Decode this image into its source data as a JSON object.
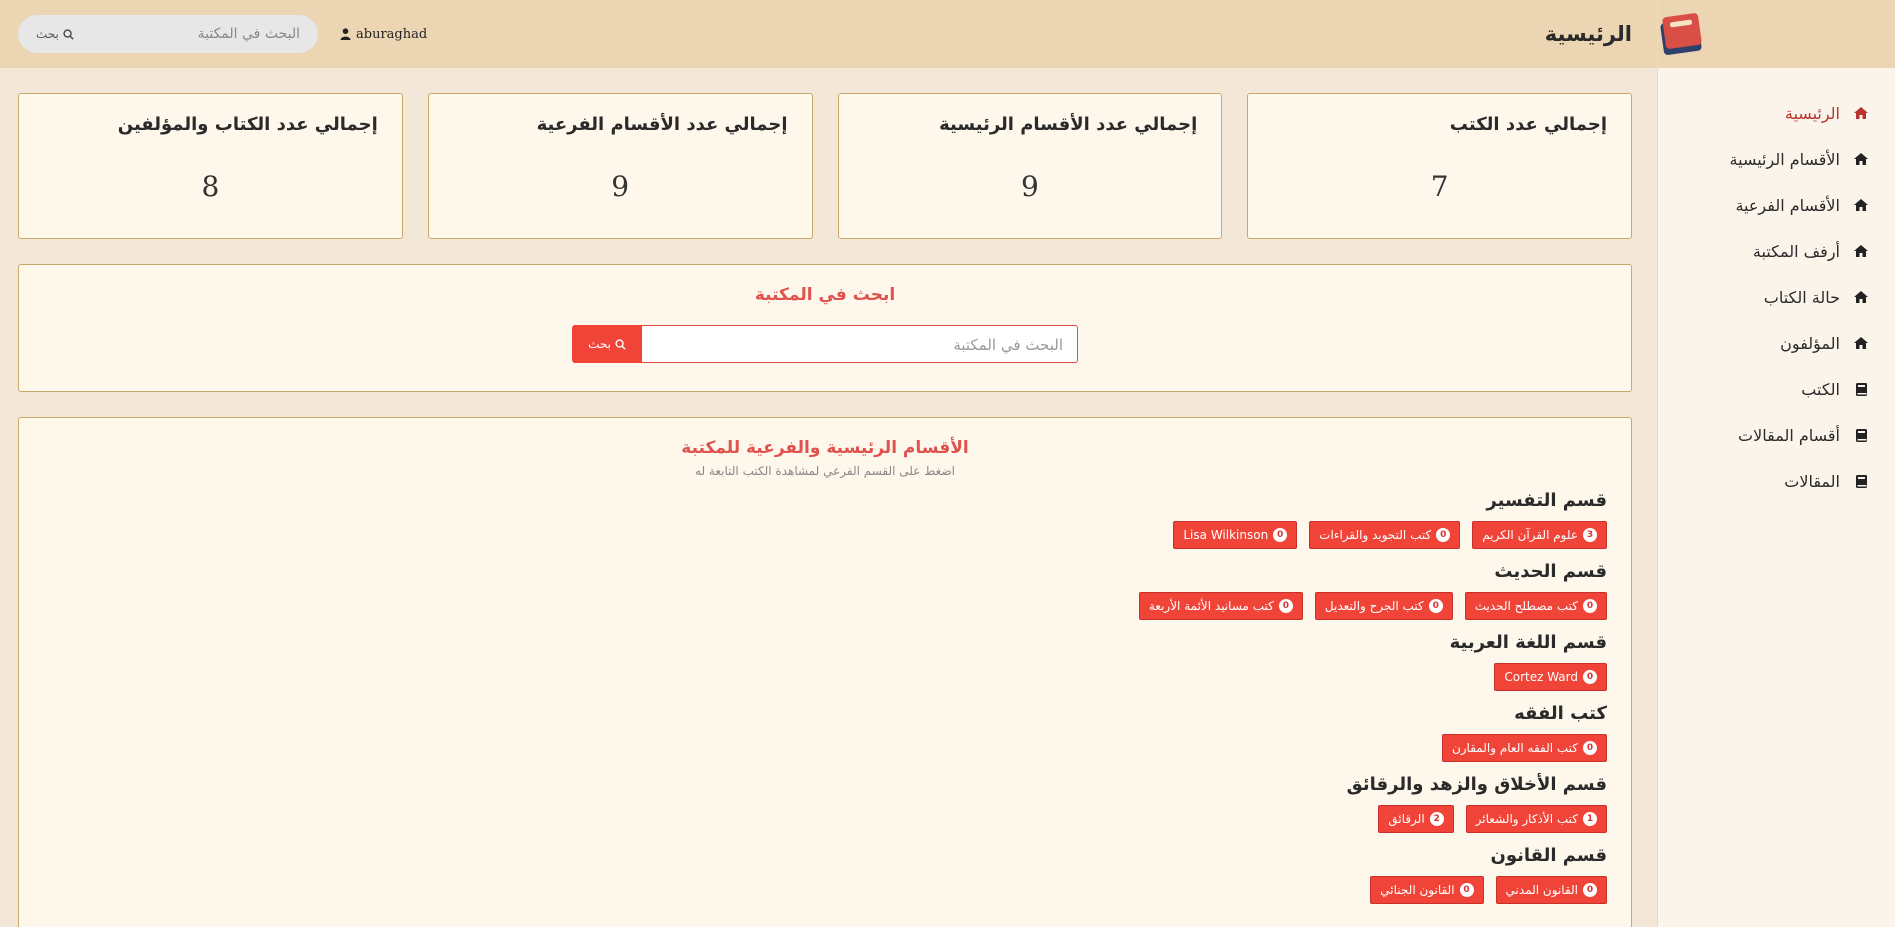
{
  "app": {
    "user": "aburaghad"
  },
  "header": {
    "title": "الرئيسية",
    "search_placeholder": "البحث في المكتبة",
    "search_button": "بحث"
  },
  "sidebar": {
    "items": [
      {
        "label": "الرئيسية",
        "icon": "home-icon"
      },
      {
        "label": "الأقسام الرئيسية",
        "icon": "home-icon"
      },
      {
        "label": "الأقسام الفرعية",
        "icon": "home-icon"
      },
      {
        "label": "أرفف المكتبة",
        "icon": "home-icon"
      },
      {
        "label": "حالة الكتاب",
        "icon": "home-icon"
      },
      {
        "label": "المؤلفون",
        "icon": "home-icon"
      },
      {
        "label": "الكتب",
        "icon": "book-icon"
      },
      {
        "label": "أقسام المقالات",
        "icon": "book-icon"
      },
      {
        "label": "المقالات",
        "icon": "book-icon"
      }
    ]
  },
  "stats": [
    {
      "title": "إجمالي عدد الكتب",
      "value": "7"
    },
    {
      "title": "إجمالي عدد الأقسام الرئيسية",
      "value": "9"
    },
    {
      "title": "إجمالي عدد الأقسام الفرعية",
      "value": "9"
    },
    {
      "title": "إجمالي عدد الكتاب والمؤلفين",
      "value": "8"
    }
  ],
  "search_panel": {
    "title": "ابحث في المكتبة",
    "placeholder": "البحث في المكتبة",
    "button": "بحث"
  },
  "categories": {
    "title": "الأقسام الرئيسية والفرعية للمكتبة",
    "subtitle": "اضغط على القسم الفرعي لمشاهدة الكتب التابعة له",
    "sections": [
      {
        "title": "قسم التفسير",
        "tags": [
          {
            "label": "علوم القرآن الكريم",
            "count": "3"
          },
          {
            "label": "كتب التجويد والقراءات",
            "count": "0"
          },
          {
            "label": "Lisa Wilkinson",
            "count": "0"
          }
        ]
      },
      {
        "title": "قسم الحديث",
        "tags": [
          {
            "label": "كتب مصطلح الحديث",
            "count": "0"
          },
          {
            "label": "كتب الجرح والتعديل",
            "count": "0"
          },
          {
            "label": "كتب مسانيد الأئمة الأربعة",
            "count": "0"
          }
        ]
      },
      {
        "title": "قسم اللغة العربية",
        "tags": [
          {
            "label": "Cortez Ward",
            "count": "0"
          }
        ]
      },
      {
        "title": "كتب الفقه",
        "tags": [
          {
            "label": "كتب الفقه العام والمقارن",
            "count": "0"
          }
        ]
      },
      {
        "title": "قسم الأخلاق والزهد والرقائق",
        "tags": [
          {
            "label": "كتب الأذكار والشعائر",
            "count": "1"
          },
          {
            "label": "الرقائق",
            "count": "2"
          }
        ]
      },
      {
        "title": "قسم القانون",
        "tags": [
          {
            "label": "القانون المدني",
            "count": "0"
          },
          {
            "label": "القانون الجنائي",
            "count": "0"
          }
        ]
      }
    ]
  }
}
